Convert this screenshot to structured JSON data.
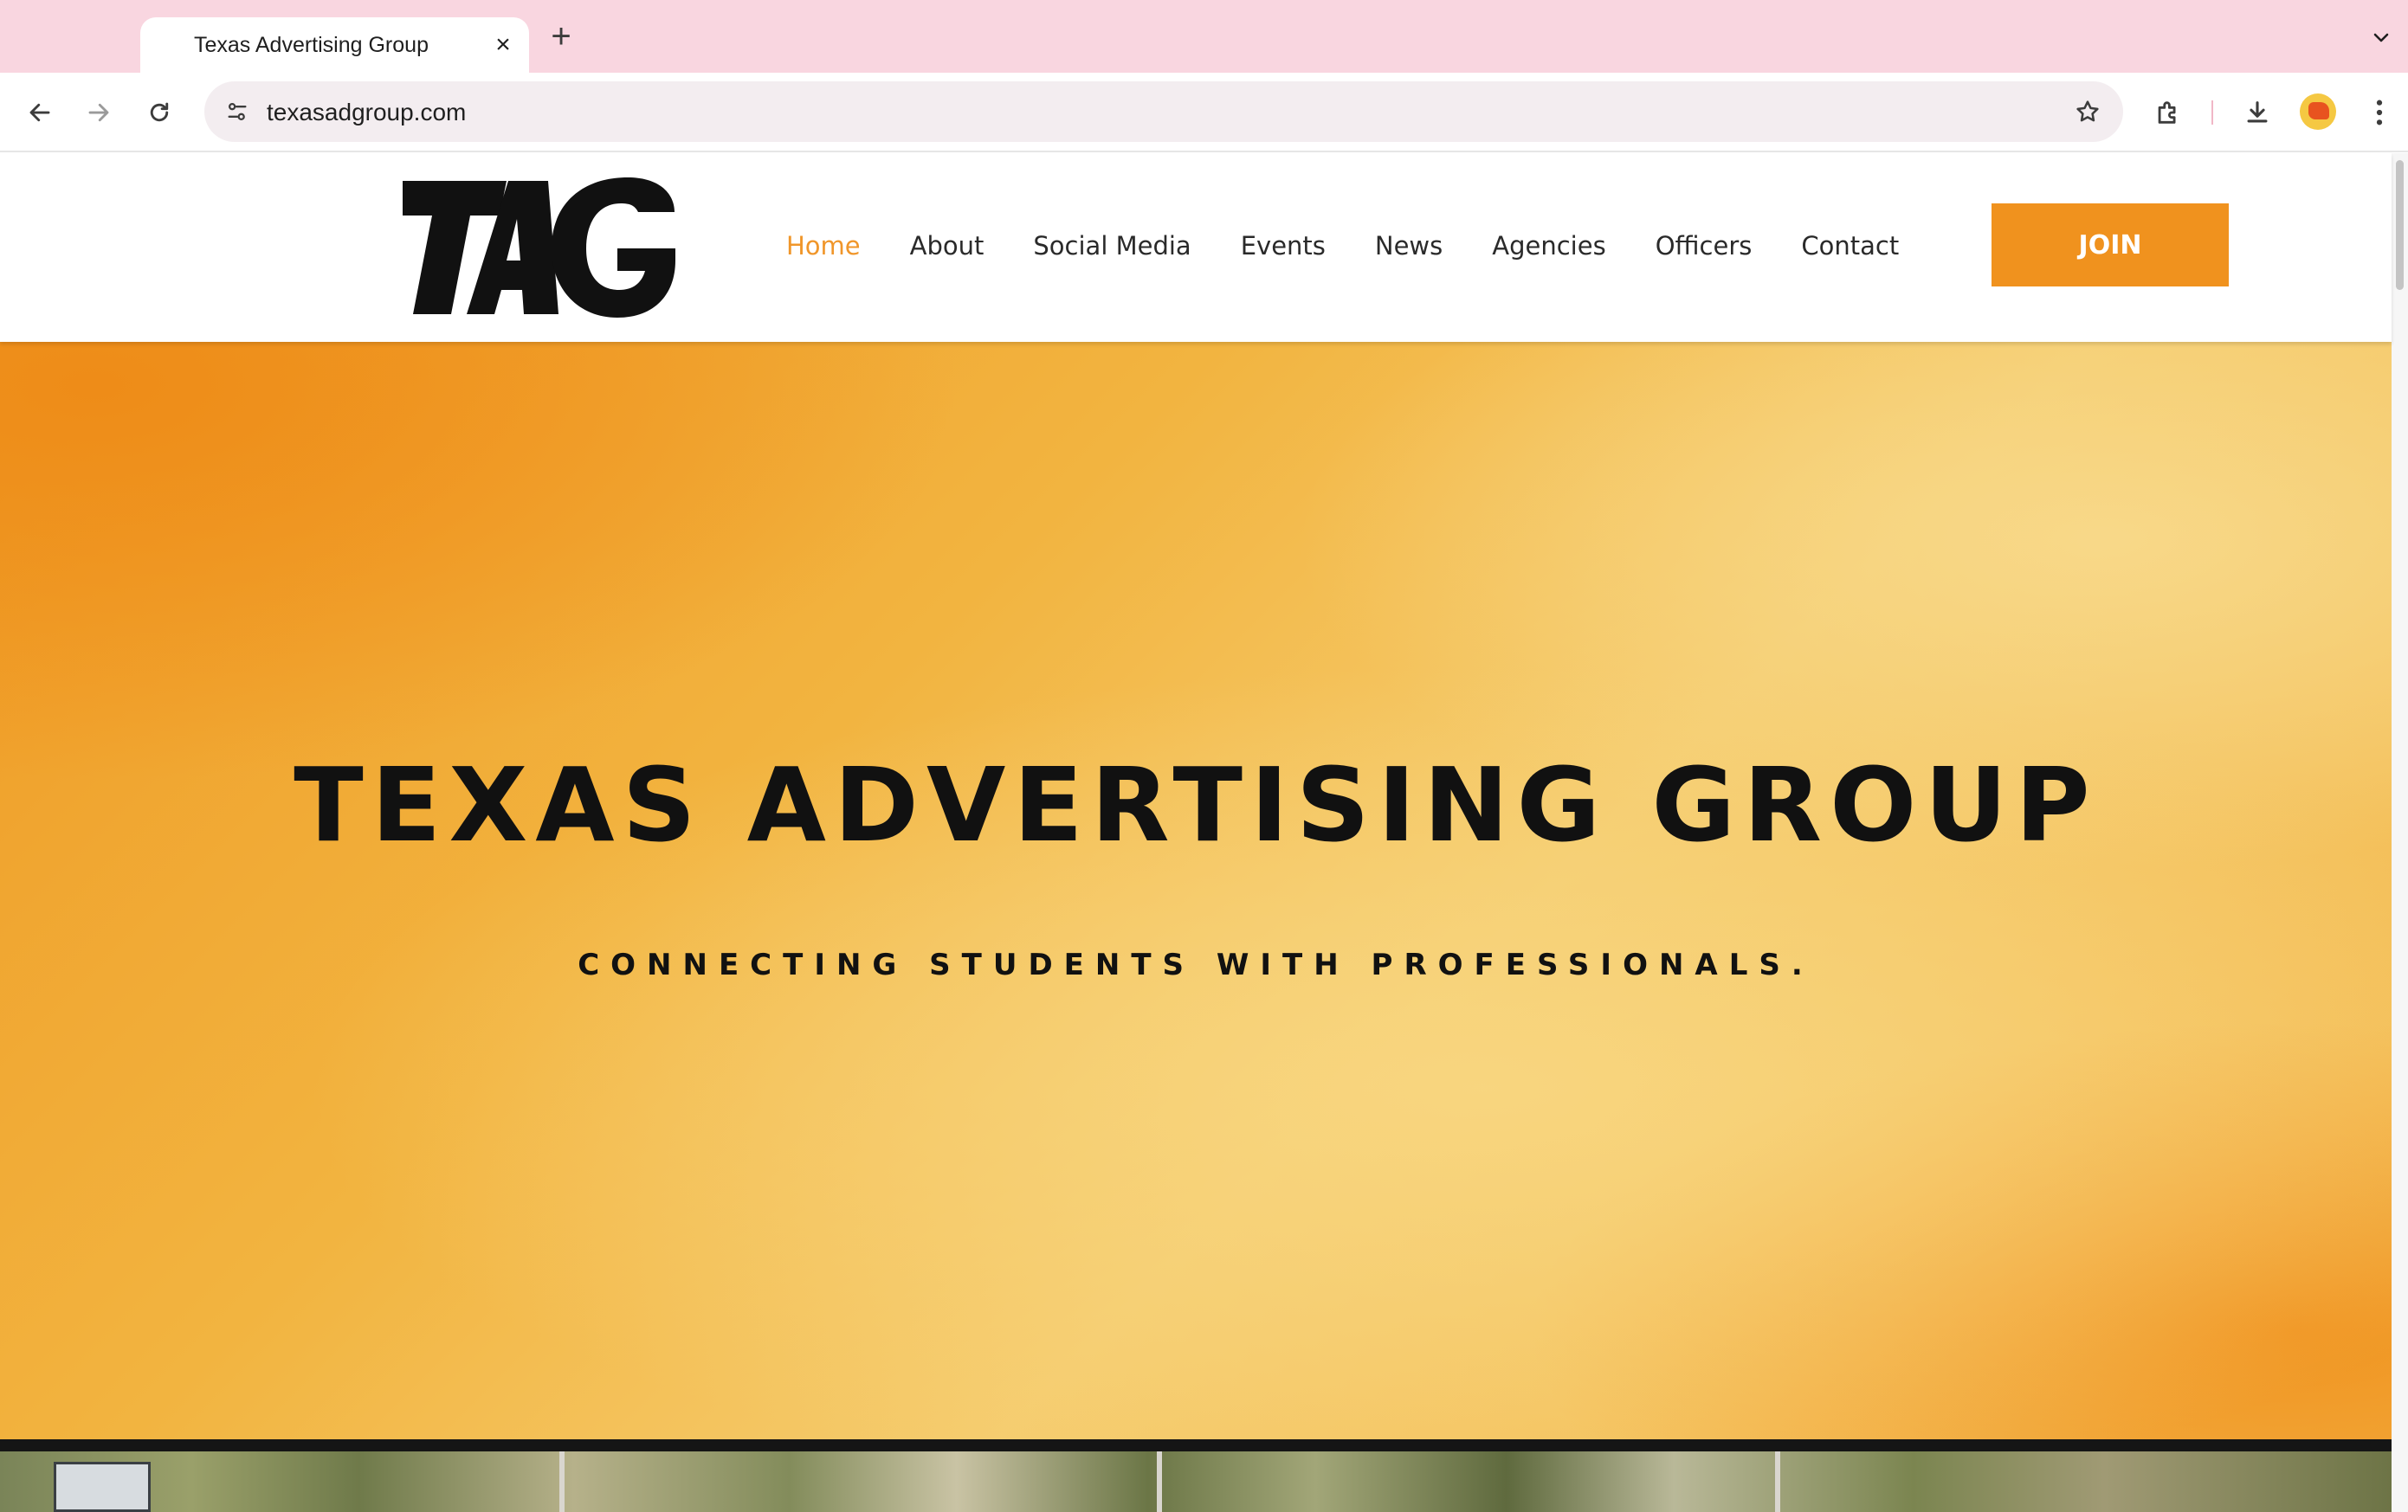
{
  "browser": {
    "tab_title": "Texas Advertising Group",
    "url": "texasadgroup.com",
    "icons": {
      "tab_close": "close-icon",
      "new_tab": "plus-icon",
      "tab_search": "chevron-down-icon",
      "back": "arrow-left-icon",
      "forward": "arrow-right-icon",
      "reload": "reload-icon",
      "site_info": "tune-icon",
      "bookmark": "star-icon",
      "extensions": "puzzle-icon",
      "downloads": "download-icon",
      "menu": "kebab-menu-icon"
    }
  },
  "site": {
    "logo_text": "TAG",
    "nav": [
      {
        "label": "Home",
        "active": true
      },
      {
        "label": "About",
        "active": false
      },
      {
        "label": "Social Media",
        "active": false
      },
      {
        "label": "Events",
        "active": false
      },
      {
        "label": "News",
        "active": false
      },
      {
        "label": "Agencies",
        "active": false
      },
      {
        "label": "Officers",
        "active": false
      },
      {
        "label": "Contact",
        "active": false
      }
    ],
    "join_label": "JOIN",
    "hero": {
      "title": "TEXAS ADVERTISING GROUP",
      "subtitle": "CONNECTING STUDENTS WITH PROFESSIONALS."
    },
    "colors": {
      "accent": "#f0921e",
      "active_nav": "#f0962a",
      "tab_strip": "#f9d6e0"
    }
  }
}
